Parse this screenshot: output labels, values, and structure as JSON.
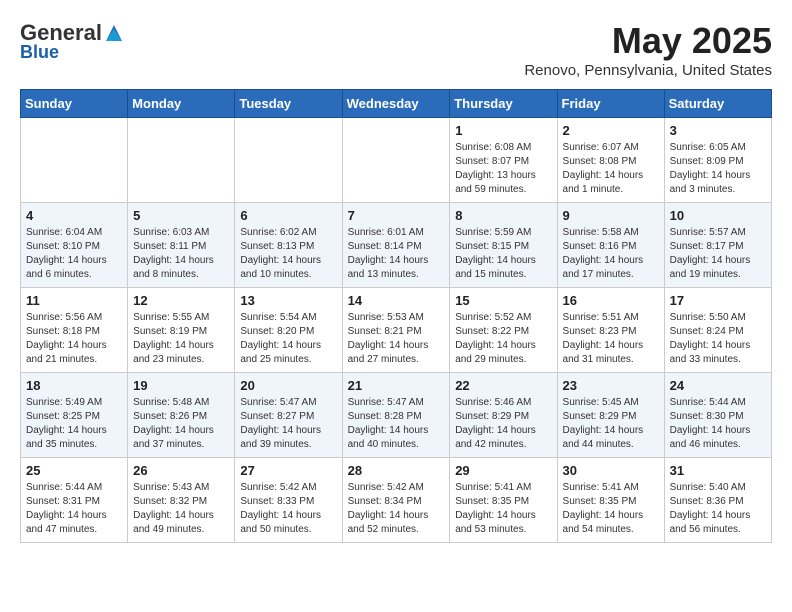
{
  "header": {
    "logo_general": "General",
    "logo_blue": "Blue",
    "month_year": "May 2025",
    "location": "Renovo, Pennsylvania, United States"
  },
  "weekdays": [
    "Sunday",
    "Monday",
    "Tuesday",
    "Wednesday",
    "Thursday",
    "Friday",
    "Saturday"
  ],
  "weeks": [
    [
      {
        "day": "",
        "content": ""
      },
      {
        "day": "",
        "content": ""
      },
      {
        "day": "",
        "content": ""
      },
      {
        "day": "",
        "content": ""
      },
      {
        "day": "1",
        "content": "Sunrise: 6:08 AM\nSunset: 8:07 PM\nDaylight: 13 hours and 59 minutes."
      },
      {
        "day": "2",
        "content": "Sunrise: 6:07 AM\nSunset: 8:08 PM\nDaylight: 14 hours and 1 minute."
      },
      {
        "day": "3",
        "content": "Sunrise: 6:05 AM\nSunset: 8:09 PM\nDaylight: 14 hours and 3 minutes."
      }
    ],
    [
      {
        "day": "4",
        "content": "Sunrise: 6:04 AM\nSunset: 8:10 PM\nDaylight: 14 hours and 6 minutes."
      },
      {
        "day": "5",
        "content": "Sunrise: 6:03 AM\nSunset: 8:11 PM\nDaylight: 14 hours and 8 minutes."
      },
      {
        "day": "6",
        "content": "Sunrise: 6:02 AM\nSunset: 8:13 PM\nDaylight: 14 hours and 10 minutes."
      },
      {
        "day": "7",
        "content": "Sunrise: 6:01 AM\nSunset: 8:14 PM\nDaylight: 14 hours and 13 minutes."
      },
      {
        "day": "8",
        "content": "Sunrise: 5:59 AM\nSunset: 8:15 PM\nDaylight: 14 hours and 15 minutes."
      },
      {
        "day": "9",
        "content": "Sunrise: 5:58 AM\nSunset: 8:16 PM\nDaylight: 14 hours and 17 minutes."
      },
      {
        "day": "10",
        "content": "Sunrise: 5:57 AM\nSunset: 8:17 PM\nDaylight: 14 hours and 19 minutes."
      }
    ],
    [
      {
        "day": "11",
        "content": "Sunrise: 5:56 AM\nSunset: 8:18 PM\nDaylight: 14 hours and 21 minutes."
      },
      {
        "day": "12",
        "content": "Sunrise: 5:55 AM\nSunset: 8:19 PM\nDaylight: 14 hours and 23 minutes."
      },
      {
        "day": "13",
        "content": "Sunrise: 5:54 AM\nSunset: 8:20 PM\nDaylight: 14 hours and 25 minutes."
      },
      {
        "day": "14",
        "content": "Sunrise: 5:53 AM\nSunset: 8:21 PM\nDaylight: 14 hours and 27 minutes."
      },
      {
        "day": "15",
        "content": "Sunrise: 5:52 AM\nSunset: 8:22 PM\nDaylight: 14 hours and 29 minutes."
      },
      {
        "day": "16",
        "content": "Sunrise: 5:51 AM\nSunset: 8:23 PM\nDaylight: 14 hours and 31 minutes."
      },
      {
        "day": "17",
        "content": "Sunrise: 5:50 AM\nSunset: 8:24 PM\nDaylight: 14 hours and 33 minutes."
      }
    ],
    [
      {
        "day": "18",
        "content": "Sunrise: 5:49 AM\nSunset: 8:25 PM\nDaylight: 14 hours and 35 minutes."
      },
      {
        "day": "19",
        "content": "Sunrise: 5:48 AM\nSunset: 8:26 PM\nDaylight: 14 hours and 37 minutes."
      },
      {
        "day": "20",
        "content": "Sunrise: 5:47 AM\nSunset: 8:27 PM\nDaylight: 14 hours and 39 minutes."
      },
      {
        "day": "21",
        "content": "Sunrise: 5:47 AM\nSunset: 8:28 PM\nDaylight: 14 hours and 40 minutes."
      },
      {
        "day": "22",
        "content": "Sunrise: 5:46 AM\nSunset: 8:29 PM\nDaylight: 14 hours and 42 minutes."
      },
      {
        "day": "23",
        "content": "Sunrise: 5:45 AM\nSunset: 8:29 PM\nDaylight: 14 hours and 44 minutes."
      },
      {
        "day": "24",
        "content": "Sunrise: 5:44 AM\nSunset: 8:30 PM\nDaylight: 14 hours and 46 minutes."
      }
    ],
    [
      {
        "day": "25",
        "content": "Sunrise: 5:44 AM\nSunset: 8:31 PM\nDaylight: 14 hours and 47 minutes."
      },
      {
        "day": "26",
        "content": "Sunrise: 5:43 AM\nSunset: 8:32 PM\nDaylight: 14 hours and 49 minutes."
      },
      {
        "day": "27",
        "content": "Sunrise: 5:42 AM\nSunset: 8:33 PM\nDaylight: 14 hours and 50 minutes."
      },
      {
        "day": "28",
        "content": "Sunrise: 5:42 AM\nSunset: 8:34 PM\nDaylight: 14 hours and 52 minutes."
      },
      {
        "day": "29",
        "content": "Sunrise: 5:41 AM\nSunset: 8:35 PM\nDaylight: 14 hours and 53 minutes."
      },
      {
        "day": "30",
        "content": "Sunrise: 5:41 AM\nSunset: 8:35 PM\nDaylight: 14 hours and 54 minutes."
      },
      {
        "day": "31",
        "content": "Sunrise: 5:40 AM\nSunset: 8:36 PM\nDaylight: 14 hours and 56 minutes."
      }
    ]
  ]
}
